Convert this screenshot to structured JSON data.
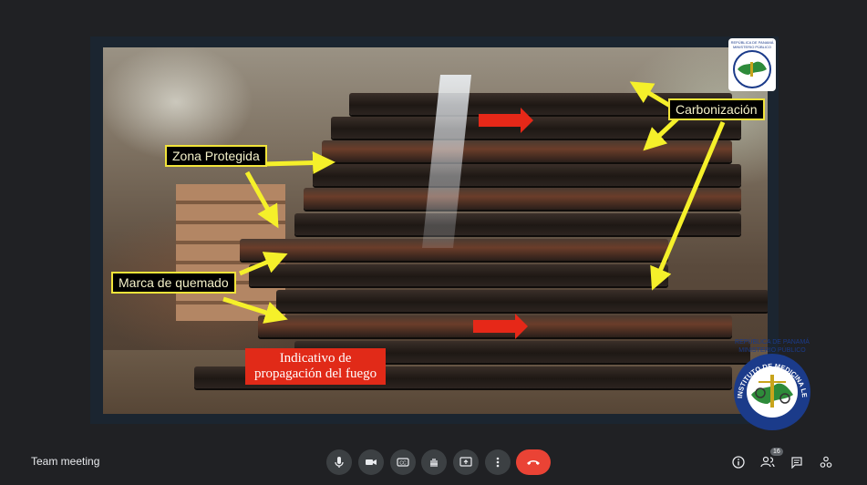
{
  "presentation": {
    "labels": {
      "zona_protegida": "Zona Protegida",
      "carbonizacion": "Carbonización",
      "marca_quemado": "Marca de quemado",
      "propagacion_line1": "Indicativo de",
      "propagacion_line2": "propagación del fuego"
    },
    "logos": {
      "small_logo_text": "REPÚBLICA DE PANAMÁ MINISTERIO PÚBLICO",
      "large_logo_header1": "REPÚBLICA DE PANAMÁ",
      "large_logo_header2": "MINISTERIO PÚBLICO",
      "large_logo_ring_text": "INSTITUTO DE MEDICINA LEGAL Y CIENCIAS FORENSES"
    },
    "colors": {
      "label_border": "#f2e43a",
      "arrow_yellow": "#f5f02a",
      "arrow_red": "#e62818",
      "background": "#202124"
    }
  },
  "meeting": {
    "name": "Team meeting",
    "participant_count": "16",
    "controls": {
      "mic": "microphone-icon",
      "camera": "camera-icon",
      "captions": "captions-icon",
      "raise_hand": "hand-icon",
      "present": "present-screen-icon",
      "more": "more-options-icon",
      "leave": "end-call-icon"
    },
    "right_controls": [
      "info-icon",
      "people-icon",
      "chat-icon",
      "activities-icon"
    ]
  }
}
